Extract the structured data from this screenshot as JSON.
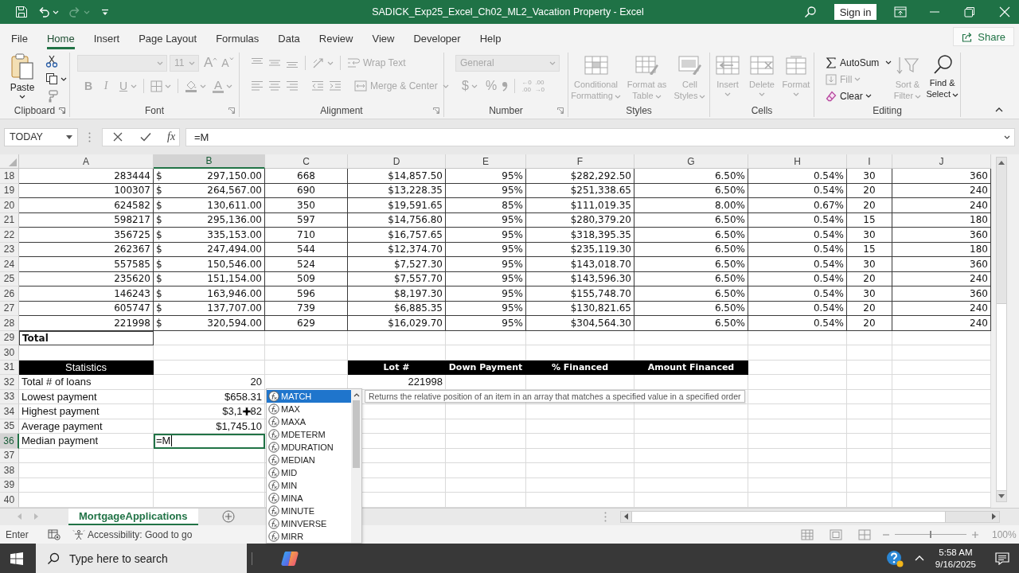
{
  "title_bar": {
    "title": "SADICK_Exp25_Excel_Ch02_ML2_Vacation Property - Excel",
    "sign_in": "Sign in",
    "undo": {
      "disabled": false
    },
    "redo": {
      "disabled": true
    }
  },
  "menu_tabs": [
    {
      "label": "File",
      "selected": false
    },
    {
      "label": "Home",
      "selected": true
    },
    {
      "label": "Insert",
      "selected": false
    },
    {
      "label": "Page Layout",
      "selected": false
    },
    {
      "label": "Formulas",
      "selected": false
    },
    {
      "label": "Data",
      "selected": false
    },
    {
      "label": "Review",
      "selected": false
    },
    {
      "label": "View",
      "selected": false
    },
    {
      "label": "Developer",
      "selected": false
    },
    {
      "label": "Help",
      "selected": false
    }
  ],
  "share": "Share",
  "ribbon": {
    "clipboard": {
      "label": "Clipboard",
      "paste": {
        "label": "Paste",
        "disabled": false
      }
    },
    "font": {
      "label": "Font",
      "size": "11",
      "grow": "A",
      "shrink": "A",
      "bold": "B",
      "italic": "I",
      "underline": "U",
      "font_color": "A",
      "disabled": true
    },
    "alignment": {
      "label": "Alignment",
      "wrap_text": "Wrap Text",
      "merge_center": "Merge & Center",
      "disabled": true
    },
    "number": {
      "label": "Number",
      "format": "General",
      "currency": "$",
      "percent": "%",
      "increase_decimal": [
        "←0",
        ".00"
      ],
      "decrease_decimal": [
        ".00",
        "→0"
      ],
      "disabled": true
    },
    "styles": {
      "label": "Styles",
      "buttons": [
        {
          "label": "Conditional Formatting",
          "disabled": true
        },
        {
          "label": "Format as Table",
          "disabled": true
        },
        {
          "label": "Cell Styles",
          "disabled": true
        }
      ]
    },
    "cells": {
      "label": "Cells",
      "buttons": [
        {
          "label": "Insert",
          "disabled": true
        },
        {
          "label": "Delete",
          "disabled": true
        },
        {
          "label": "Format",
          "disabled": true
        }
      ]
    },
    "editing": {
      "label": "Editing",
      "autosum": {
        "label": "AutoSum",
        "disabled": false
      },
      "fill": {
        "label": "Fill",
        "disabled": true
      },
      "clear": {
        "label": "Clear",
        "disabled": false
      },
      "sort_filter": {
        "label": "Sort & Filter",
        "disabled": true
      },
      "find_select": {
        "label": "Find & Select",
        "disabled": false
      }
    }
  },
  "formula_bar": {
    "name_box": "TODAY",
    "insert_function": "fx",
    "formula": "=M"
  },
  "sheet": {
    "columns": [
      {
        "label": "A",
        "selected": false
      },
      {
        "label": "B",
        "selected": true
      },
      {
        "label": "C",
        "selected": false
      },
      {
        "label": "D",
        "selected": false
      },
      {
        "label": "E",
        "selected": false
      },
      {
        "label": "F",
        "selected": false
      },
      {
        "label": "G",
        "selected": false
      },
      {
        "label": "H",
        "selected": false
      },
      {
        "label": "I",
        "selected": false
      },
      {
        "label": "J",
        "selected": false
      }
    ],
    "rows": [
      {
        "number": "18",
        "selected": false,
        "bordered": true,
        "cells": [
          {
            "text": "283444",
            "kind": "number"
          },
          {
            "symbol": "$",
            "text": "297,150.00",
            "kind": "accounting"
          },
          {
            "text": "668",
            "kind": "centered"
          },
          {
            "text": "$14,857.50",
            "kind": "number"
          },
          {
            "text": "95%",
            "kind": "number"
          },
          {
            "text": "$282,292.50",
            "kind": "number"
          },
          {
            "text": "6.50%",
            "kind": "number"
          },
          {
            "text": "0.54%",
            "kind": "number"
          },
          {
            "text": "30",
            "kind": "centered"
          },
          {
            "text": "360",
            "kind": "number"
          }
        ]
      },
      {
        "number": "19",
        "selected": false,
        "bordered": true,
        "cells": [
          {
            "text": "100307",
            "kind": "number"
          },
          {
            "symbol": "$",
            "text": "264,567.00",
            "kind": "accounting"
          },
          {
            "text": "690",
            "kind": "centered"
          },
          {
            "text": "$13,228.35",
            "kind": "number"
          },
          {
            "text": "95%",
            "kind": "number"
          },
          {
            "text": "$251,338.65",
            "kind": "number"
          },
          {
            "text": "6.50%",
            "kind": "number"
          },
          {
            "text": "0.54%",
            "kind": "number"
          },
          {
            "text": "20",
            "kind": "centered"
          },
          {
            "text": "240",
            "kind": "number"
          }
        ]
      },
      {
        "number": "20",
        "selected": false,
        "bordered": true,
        "cells": [
          {
            "text": "624582",
            "kind": "number"
          },
          {
            "symbol": "$",
            "text": "130,611.00",
            "kind": "accounting"
          },
          {
            "text": "350",
            "kind": "centered"
          },
          {
            "text": "$19,591.65",
            "kind": "number"
          },
          {
            "text": "85%",
            "kind": "number"
          },
          {
            "text": "$111,019.35",
            "kind": "number"
          },
          {
            "text": "8.00%",
            "kind": "number"
          },
          {
            "text": "0.67%",
            "kind": "number"
          },
          {
            "text": "20",
            "kind": "centered"
          },
          {
            "text": "240",
            "kind": "number"
          }
        ]
      },
      {
        "number": "21",
        "selected": false,
        "bordered": true,
        "cells": [
          {
            "text": "598217",
            "kind": "number"
          },
          {
            "symbol": "$",
            "text": "295,136.00",
            "kind": "accounting"
          },
          {
            "text": "597",
            "kind": "centered"
          },
          {
            "text": "$14,756.80",
            "kind": "number"
          },
          {
            "text": "95%",
            "kind": "number"
          },
          {
            "text": "$280,379.20",
            "kind": "number"
          },
          {
            "text": "6.50%",
            "kind": "number"
          },
          {
            "text": "0.54%",
            "kind": "number"
          },
          {
            "text": "15",
            "kind": "centered"
          },
          {
            "text": "180",
            "kind": "number"
          }
        ]
      },
      {
        "number": "22",
        "selected": false,
        "bordered": true,
        "cells": [
          {
            "text": "356725",
            "kind": "number"
          },
          {
            "symbol": "$",
            "text": "335,153.00",
            "kind": "accounting"
          },
          {
            "text": "710",
            "kind": "centered"
          },
          {
            "text": "$16,757.65",
            "kind": "number"
          },
          {
            "text": "95%",
            "kind": "number"
          },
          {
            "text": "$318,395.35",
            "kind": "number"
          },
          {
            "text": "6.50%",
            "kind": "number"
          },
          {
            "text": "0.54%",
            "kind": "number"
          },
          {
            "text": "30",
            "kind": "centered"
          },
          {
            "text": "360",
            "kind": "number"
          }
        ]
      },
      {
        "number": "23",
        "selected": false,
        "bordered": true,
        "cells": [
          {
            "text": "262367",
            "kind": "number"
          },
          {
            "symbol": "$",
            "text": "247,494.00",
            "kind": "accounting"
          },
          {
            "text": "544",
            "kind": "centered"
          },
          {
            "text": "$12,374.70",
            "kind": "number"
          },
          {
            "text": "95%",
            "kind": "number"
          },
          {
            "text": "$235,119.30",
            "kind": "number"
          },
          {
            "text": "6.50%",
            "kind": "number"
          },
          {
            "text": "0.54%",
            "kind": "number"
          },
          {
            "text": "15",
            "kind": "centered"
          },
          {
            "text": "180",
            "kind": "number"
          }
        ]
      },
      {
        "number": "24",
        "selected": false,
        "bordered": true,
        "cells": [
          {
            "text": "557585",
            "kind": "number"
          },
          {
            "symbol": "$",
            "text": "150,546.00",
            "kind": "accounting"
          },
          {
            "text": "524",
            "kind": "centered"
          },
          {
            "text": "$7,527.30",
            "kind": "number"
          },
          {
            "text": "95%",
            "kind": "number"
          },
          {
            "text": "$143,018.70",
            "kind": "number"
          },
          {
            "text": "6.50%",
            "kind": "number"
          },
          {
            "text": "0.54%",
            "kind": "number"
          },
          {
            "text": "30",
            "kind": "centered"
          },
          {
            "text": "360",
            "kind": "number"
          }
        ]
      },
      {
        "number": "25",
        "selected": false,
        "bordered": true,
        "cells": [
          {
            "text": "235620",
            "kind": "number"
          },
          {
            "symbol": "$",
            "text": "151,154.00",
            "kind": "accounting"
          },
          {
            "text": "509",
            "kind": "centered"
          },
          {
            "text": "$7,557.70",
            "kind": "number"
          },
          {
            "text": "95%",
            "kind": "number"
          },
          {
            "text": "$143,596.30",
            "kind": "number"
          },
          {
            "text": "6.50%",
            "kind": "number"
          },
          {
            "text": "0.54%",
            "kind": "number"
          },
          {
            "text": "20",
            "kind": "centered"
          },
          {
            "text": "240",
            "kind": "number"
          }
        ]
      },
      {
        "number": "26",
        "selected": false,
        "bordered": true,
        "cells": [
          {
            "text": "146243",
            "kind": "number"
          },
          {
            "symbol": "$",
            "text": "163,946.00",
            "kind": "accounting"
          },
          {
            "text": "596",
            "kind": "centered"
          },
          {
            "text": "$8,197.30",
            "kind": "number"
          },
          {
            "text": "95%",
            "kind": "number"
          },
          {
            "text": "$155,748.70",
            "kind": "number"
          },
          {
            "text": "6.50%",
            "kind": "number"
          },
          {
            "text": "0.54%",
            "kind": "number"
          },
          {
            "text": "30",
            "kind": "centered"
          },
          {
            "text": "360",
            "kind": "number"
          }
        ]
      },
      {
        "number": "27",
        "selected": false,
        "bordered": true,
        "cells": [
          {
            "text": "605747",
            "kind": "number"
          },
          {
            "symbol": "$",
            "text": "137,707.00",
            "kind": "accounting"
          },
          {
            "text": "739",
            "kind": "centered"
          },
          {
            "text": "$6,885.35",
            "kind": "number"
          },
          {
            "text": "95%",
            "kind": "number"
          },
          {
            "text": "$130,821.65",
            "kind": "number"
          },
          {
            "text": "6.50%",
            "kind": "number"
          },
          {
            "text": "0.54%",
            "kind": "number"
          },
          {
            "text": "20",
            "kind": "centered"
          },
          {
            "text": "240",
            "kind": "number"
          }
        ]
      },
      {
        "number": "28",
        "selected": false,
        "bordered": true,
        "cells": [
          {
            "text": "221998",
            "kind": "number"
          },
          {
            "symbol": "$",
            "text": "320,594.00",
            "kind": "accounting"
          },
          {
            "text": "629",
            "kind": "centered"
          },
          {
            "text": "$16,029.70",
            "kind": "number"
          },
          {
            "text": "95%",
            "kind": "number"
          },
          {
            "text": "$304,564.30",
            "kind": "number"
          },
          {
            "text": "6.50%",
            "kind": "number"
          },
          {
            "text": "0.54%",
            "kind": "number"
          },
          {
            "text": "20",
            "kind": "centered"
          },
          {
            "text": "240",
            "kind": "number"
          }
        ]
      },
      {
        "number": "29",
        "selected": false,
        "bordered": false,
        "cells": [
          {
            "text": "Total",
            "kind": "label",
            "bold": true,
            "bordered": true
          }
        ]
      },
      {
        "number": "30",
        "selected": false,
        "bordered": false
      },
      {
        "number": "31",
        "selected": false,
        "bordered": false,
        "cells": [
          {
            "text": "Statistics",
            "kind": "header",
            "bold": false
          },
          {},
          {},
          {
            "text": "Lot #",
            "kind": "header",
            "bold": true
          },
          {
            "text": "Down Payment",
            "kind": "header",
            "bold": true
          },
          {
            "text": "% Financed",
            "kind": "header",
            "bold": true
          },
          {
            "text": "Amount Financed",
            "kind": "header",
            "bold": true
          }
        ]
      },
      {
        "number": "32",
        "selected": false,
        "bordered": false,
        "cells": [
          {
            "text": "Total # of loans",
            "kind": "label"
          },
          {
            "text": "20",
            "kind": "number"
          },
          {},
          {
            "text": "221998",
            "kind": "number"
          }
        ]
      },
      {
        "number": "33",
        "selected": false,
        "bordered": false,
        "cells": [
          {
            "text": "Lowest payment",
            "kind": "label"
          },
          {
            "text": "$658.31",
            "kind": "number"
          }
        ]
      },
      {
        "number": "34",
        "selected": false,
        "bordered": false,
        "cells": [
          {
            "text": "Highest payment",
            "kind": "label"
          },
          {
            "text": "$3,1",
            "text_after_pointer": "82",
            "kind": "number",
            "pointer": true
          }
        ]
      },
      {
        "number": "35",
        "selected": false,
        "bordered": false,
        "cells": [
          {
            "text": "Average payment",
            "kind": "label"
          },
          {
            "text": "$1,745.10",
            "kind": "number"
          }
        ]
      },
      {
        "number": "36",
        "selected": true,
        "bordered": false,
        "cells": [
          {
            "text": "Median payment",
            "kind": "label"
          },
          {
            "text": "=M",
            "kind": "editing"
          }
        ]
      },
      {
        "number": "37",
        "selected": false,
        "bordered": false
      },
      {
        "number": "38",
        "selected": false,
        "bordered": false
      },
      {
        "number": "39",
        "selected": false,
        "bordered": false
      },
      {
        "number": "40",
        "selected": false,
        "bordered": false
      }
    ]
  },
  "autocomplete": {
    "items": [
      {
        "label": "MATCH",
        "selected": true
      },
      {
        "label": "MAX",
        "selected": false
      },
      {
        "label": "MAXA",
        "selected": false
      },
      {
        "label": "MDETERM",
        "selected": false
      },
      {
        "label": "MDURATION",
        "selected": false
      },
      {
        "label": "MEDIAN",
        "selected": false
      },
      {
        "label": "MID",
        "selected": false
      },
      {
        "label": "MIN",
        "selected": false
      },
      {
        "label": "MINA",
        "selected": false
      },
      {
        "label": "MINUTE",
        "selected": false
      },
      {
        "label": "MINVERSE",
        "selected": false
      },
      {
        "label": "MIRR",
        "selected": false
      }
    ],
    "tooltip": "Returns the relative position of an item in an array that matches a specified value in a specified order"
  },
  "sheet_tabs": [
    {
      "label": "MortgageApplications",
      "selected": true
    }
  ],
  "status_bar": {
    "mode": "Enter",
    "accessibility": "Accessibility: Good to go",
    "zoom": "100%",
    "zoom_slider": {
      "level": 0.5
    }
  },
  "taskbar": {
    "search_placeholder": "Type here to search",
    "time": "5:58 AM",
    "date": "9/16/2025"
  }
}
